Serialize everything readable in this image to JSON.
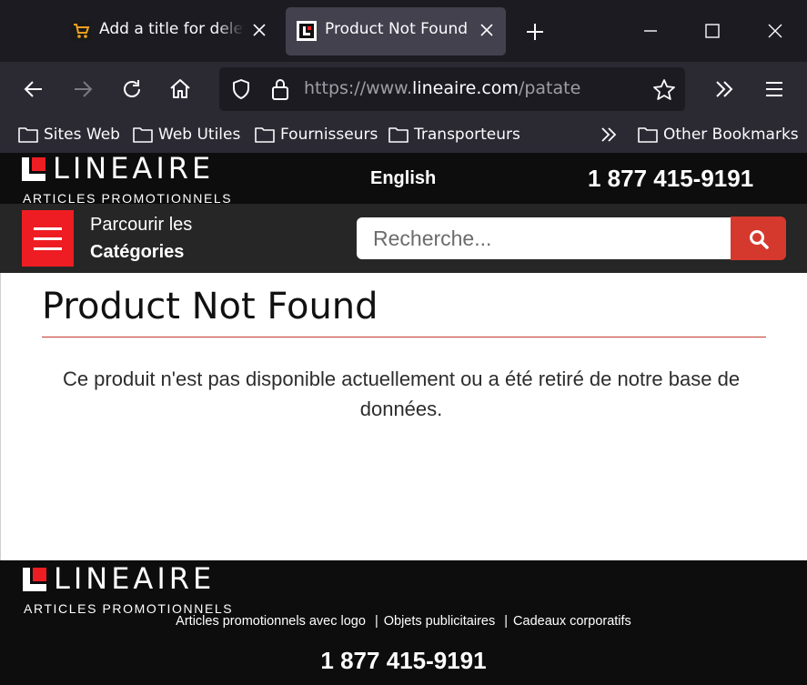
{
  "browser": {
    "tabs": [
      {
        "title": "Add a title for delete",
        "active": false
      },
      {
        "title": "Product Not Found",
        "active": true
      }
    ],
    "url": {
      "scheme": "https://www.",
      "host": "lineaire.com",
      "path": "/patate"
    },
    "bookmarks": [
      "Sites Web",
      "Web Utiles",
      "Fournisseurs",
      "Transporteurs"
    ],
    "other_bookmarks": "Other Bookmarks",
    "icons": [
      "back-icon",
      "forward-icon",
      "reload-icon",
      "home-icon",
      "shield-icon",
      "lock-icon",
      "star-icon",
      "overflow-icon",
      "menu-icon",
      "folder-icon"
    ]
  },
  "site": {
    "brand": "LINEAIRE",
    "tagline": "ARTICLES PROMOTIONNELS",
    "language_link": "English",
    "phone": "1 877 415-9191",
    "browse_line1": "Parcourir les",
    "browse_line2": "Catégories",
    "search_placeholder": "Recherche...",
    "colors": {
      "brand_red": "#ee1d23",
      "search_button": "#d5392d",
      "header_bg": "#0d0d0d",
      "nav_bg": "#262626"
    }
  },
  "content": {
    "title": "Product Not Found",
    "message": "Ce produit n'est pas disponible actuellement ou a été retiré de notre base de données."
  },
  "footer": {
    "brand": "LINEAIRE",
    "tagline": "ARTICLES PROMOTIONNELS",
    "links": [
      "Articles promotionnels avec logo",
      "Objets publicitaires",
      "Cadeaux corporatifs"
    ],
    "separator": "|",
    "phone": "1 877 415-9191"
  }
}
